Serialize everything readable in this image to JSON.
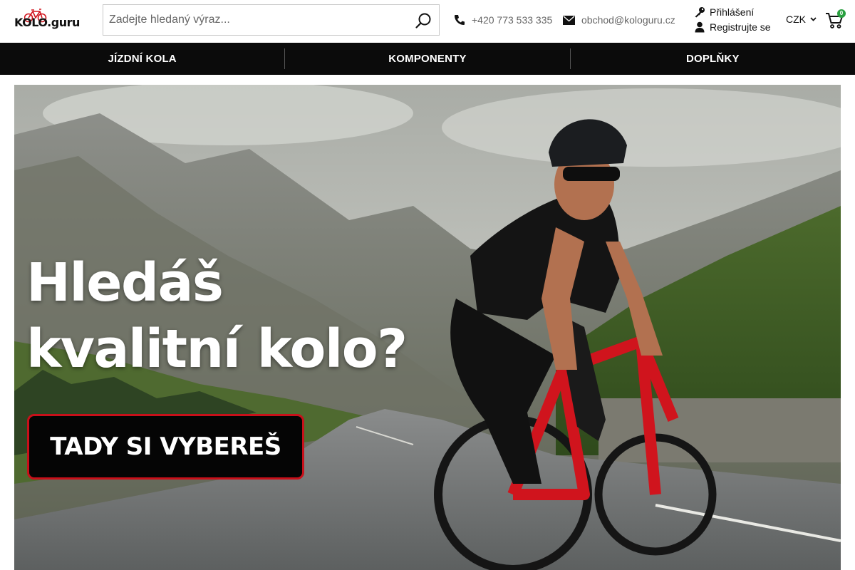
{
  "brand": {
    "logo_text": "KOLO.guru"
  },
  "search": {
    "placeholder": "Zadejte hledaný výraz...",
    "value": ""
  },
  "contact": {
    "phone": "+420 773 533 335",
    "email": "obchod@kologuru.cz"
  },
  "account": {
    "login_label": "Přihlášení",
    "register_label": "Registrujte se"
  },
  "currency": {
    "selected": "CZK"
  },
  "cart": {
    "count": "0"
  },
  "nav": {
    "items": [
      {
        "label": "JÍZDNÍ KOLA"
      },
      {
        "label": "KOMPONENTY"
      },
      {
        "label": "DOPLŇKY"
      }
    ]
  },
  "hero": {
    "title_line1": "Hledáš",
    "title_line2": "kvalitní kolo?",
    "cta_label": "TADY SI VYBEREŠ"
  },
  "colors": {
    "accent_red": "#c8101a",
    "nav_bg": "#0b0b0b",
    "cart_badge": "#2aa040"
  },
  "icons": [
    "bike-logo-icon",
    "search-icon",
    "phone-icon",
    "mail-icon",
    "key-icon",
    "user-icon",
    "chevron-down-icon",
    "cart-icon"
  ]
}
